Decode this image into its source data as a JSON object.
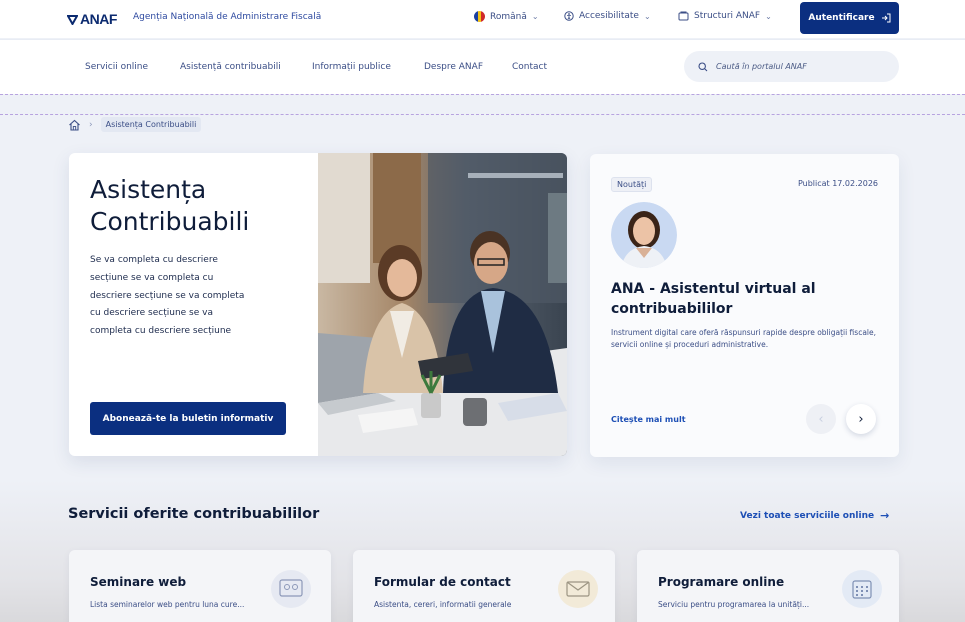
{
  "header": {
    "logo": "ANAF",
    "agency": "Agenția Națională de Administrare Fiscală",
    "language": "Română",
    "accessibility": "Accesibilitate",
    "structures": "Structuri ANAF",
    "login": "Autentificare"
  },
  "nav": {
    "items": [
      "Servicii online",
      "Asistență contribuabili",
      "Informații publice",
      "Despre ANAF",
      "Contact"
    ],
    "search_placeholder": "Caută în portalul ANAF"
  },
  "breadcrumb": {
    "current": "Asistența Contribuabili"
  },
  "hero": {
    "title": "Asistența Contribuabili",
    "description": "Se va completa cu descriere secțiune se va completa cu descriere secțiune se va completa cu descriere secțiune se va completa cu descriere secțiune",
    "button": "Abonează-te la buletin informativ"
  },
  "news": {
    "tag": "Noutăți",
    "date": "Publicat 17.02.2026",
    "title": "ANA - Asistentul virtual al contribuabililor",
    "description": "Instrument digital care oferă răspunsuri rapide despre obligații fiscale, servicii online și proceduri administrative.",
    "read_more": "Citește mai mult"
  },
  "services": {
    "title": "Servicii oferite contribuabililor",
    "view_all": "Vezi toate serviciile online",
    "cards": [
      {
        "title": "Seminare web",
        "desc": "Lista seminarelor web pentru luna cure..."
      },
      {
        "title": "Formular de contact",
        "desc": "Asistenta, cereri, informatii generale"
      },
      {
        "title": "Programare online",
        "desc": "Serviciu pentru programarea la unități..."
      }
    ]
  },
  "colors": {
    "primary": "#0b2f80",
    "link": "#1d4fb5",
    "background": "#eef1f7"
  }
}
